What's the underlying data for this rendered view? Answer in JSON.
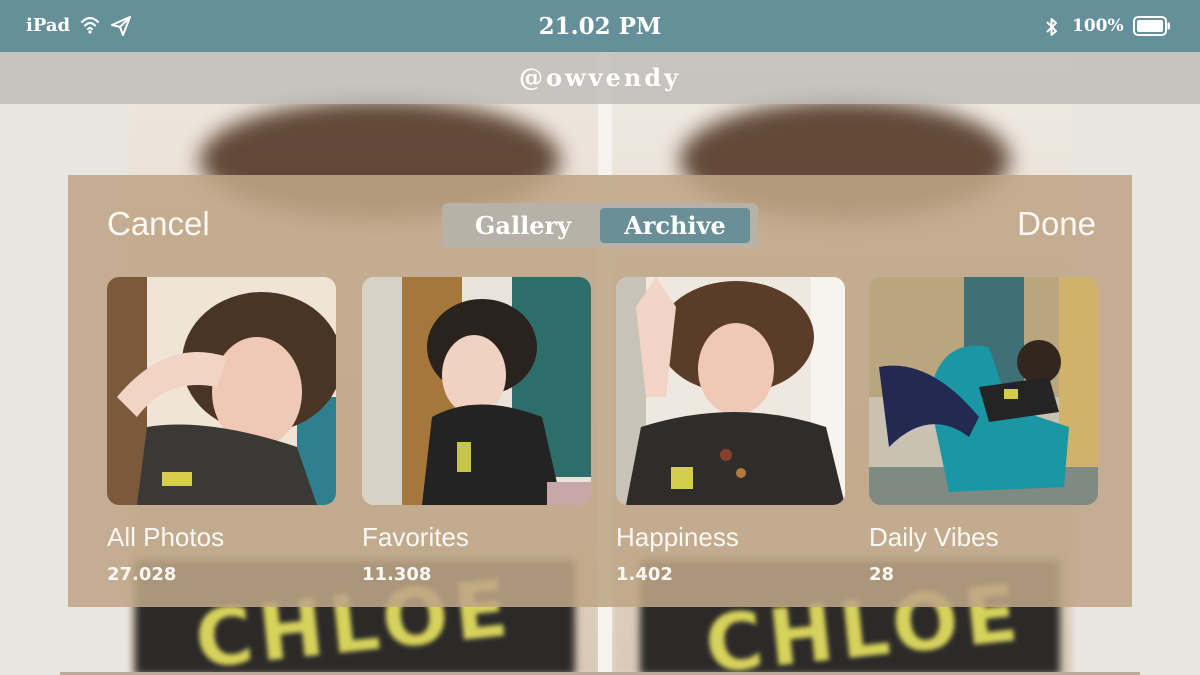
{
  "status_bar": {
    "device": "iPad",
    "time": "21.02 PM",
    "battery_percent": "100%",
    "wifi_icon": "wifi-icon",
    "send_icon": "send-icon",
    "bluetooth_icon": "bluetooth-icon",
    "battery_icon": "battery-icon"
  },
  "profile": {
    "username": "@owvendy"
  },
  "background_text": {
    "shirt_print": "CHLOE"
  },
  "picker": {
    "cancel_label": "Cancel",
    "done_label": "Done",
    "tabs": [
      {
        "label": "Gallery",
        "selected": false
      },
      {
        "label": "Archive",
        "selected": true
      }
    ],
    "albums": [
      {
        "title": "All Photos",
        "count": "27.028"
      },
      {
        "title": "Favorites",
        "count": "11.308"
      },
      {
        "title": "Happiness",
        "count": "1.402"
      },
      {
        "title": "Daily Vibes",
        "count": "28"
      }
    ]
  },
  "colors": {
    "status_bar": "#658f99",
    "selected_tab": "#6a8f97",
    "panel": "#bea586",
    "text": "#fbf8f4"
  }
}
